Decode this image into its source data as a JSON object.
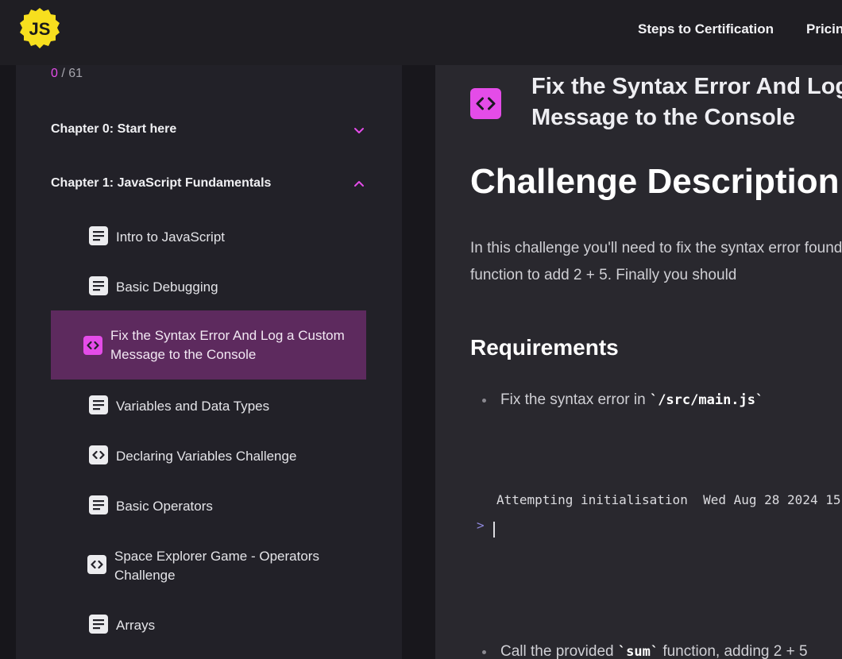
{
  "header": {
    "logo_text": "JS",
    "nav": {
      "steps": "Steps to Certification",
      "pricing": "Pricin"
    }
  },
  "sidebar": {
    "progress": {
      "done": "0",
      "separator": " / ",
      "total": "61"
    },
    "chapters": [
      {
        "label": "Chapter 0: Start here",
        "state": "collapsed"
      },
      {
        "label": "Chapter 1: JavaScript Fundamentals",
        "state": "expanded"
      }
    ],
    "lessons": [
      {
        "label": "Intro to JavaScript",
        "icon": "document-icon"
      },
      {
        "label": "Basic Debugging",
        "icon": "document-icon"
      },
      {
        "label": "Fix the Syntax Error And Log a Custom Message to the Console",
        "icon": "code-icon",
        "active": true
      },
      {
        "label": "Variables and Data Types",
        "icon": "document-icon"
      },
      {
        "label": "Declaring Variables Challenge",
        "icon": "code-icon"
      },
      {
        "label": "Basic Operators",
        "icon": "document-icon"
      },
      {
        "label": "Space Explorer Game - Operators Challenge",
        "icon": "code-icon"
      },
      {
        "label": "Arrays",
        "icon": "document-icon"
      }
    ]
  },
  "main": {
    "lesson_title": "Fix the Syntax Error And Log a Custom Message to the Console",
    "heading": "Challenge Description",
    "description": "In this challenge you'll need to fix the syntax error found in the provided sum function to add 2 + 5. Finally you should",
    "requirements_heading": "Requirements",
    "requirements": [
      {
        "before": "Fix the syntax error in ",
        "code": "`/src/main.js`",
        "after": ""
      },
      {
        "before": "Call the provided ",
        "code": "`sum`",
        "after": " function, adding 2 + 5"
      }
    ],
    "terminal": {
      "line": "Attempting initialisation  Wed Aug 28 2024 15",
      "prompt": ">"
    }
  },
  "colors": {
    "accent": "#e44ce8",
    "active_row": "#5d2a5e",
    "logo": "#f7df1e"
  }
}
